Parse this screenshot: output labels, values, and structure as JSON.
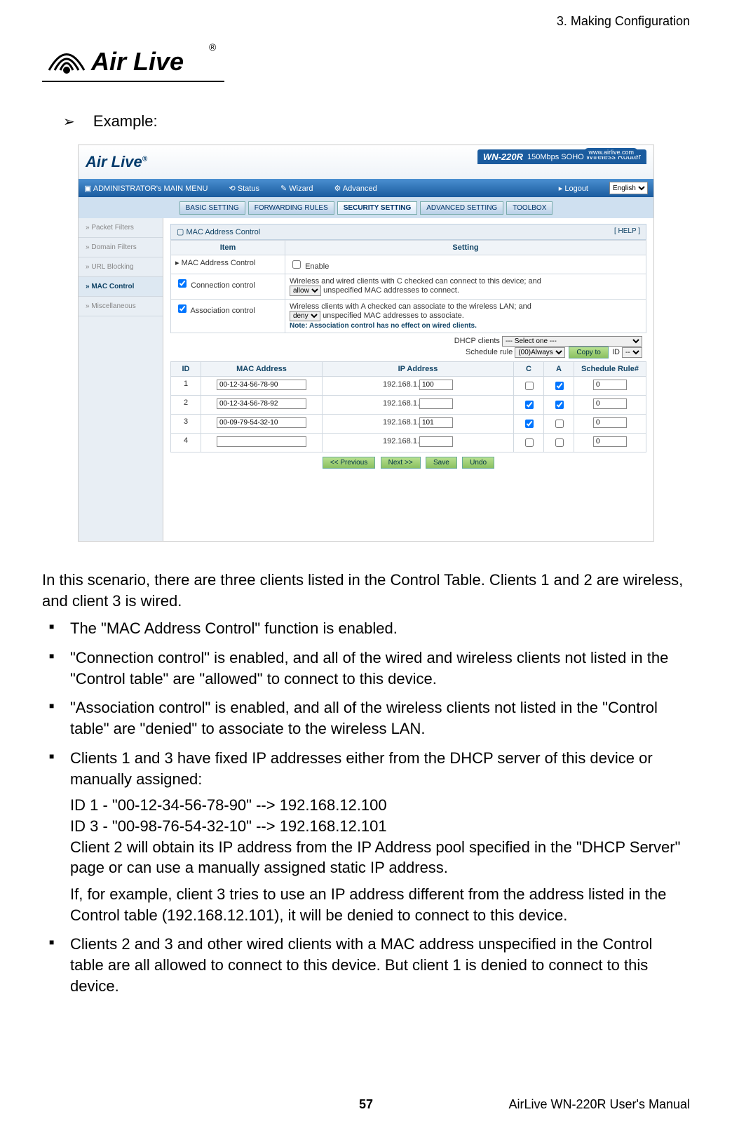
{
  "header": {
    "chapter": "3. Making Configuration"
  },
  "logo_text": "Air Live",
  "example_label": "Example:",
  "screenshot": {
    "url_pill": "www.airlive.com",
    "model": "WN-220R",
    "model_desc": "150Mbps SOHO Wireless Router",
    "menubar": {
      "main": "ADMINISTRATOR's MAIN MENU",
      "status": "Status",
      "wizard": "Wizard",
      "advanced": "Advanced",
      "logout": "Logout",
      "lang": "English"
    },
    "tabs": [
      "BASIC SETTING",
      "FORWARDING RULES",
      "SECURITY SETTING",
      "ADVANCED SETTING",
      "TOOLBOX"
    ],
    "sidebar": [
      "Packet Filters",
      "Domain Filters",
      "URL Blocking",
      "MAC Control",
      "Miscellaneous"
    ],
    "panel_title": "MAC Address Control",
    "panel_help": "[ HELP ]",
    "col_item": "Item",
    "col_setting": "Setting",
    "row_mac_label": "MAC Address Control",
    "row_mac_enable": "Enable",
    "row_conn_label": "Connection control",
    "row_conn_text1": "Wireless and wired clients with C checked can connect to this device; and",
    "row_conn_select": "allow",
    "row_conn_text2": "unspecified MAC addresses to connect.",
    "row_assoc_label": "Association control",
    "row_assoc_text1": "Wireless clients with A checked can associate to the wireless LAN; and",
    "row_assoc_select": "deny",
    "row_assoc_text2": "unspecified MAC addresses to associate.",
    "row_assoc_note": "Note: Association control has no effect on wired clients.",
    "dhcp_label": "DHCP clients",
    "dhcp_select": "--- Select one ---",
    "sched_label": "Schedule rule",
    "sched_select": "(00)Always",
    "copy_btn": "Copy to",
    "id_label": "ID",
    "id_select": "--",
    "cols": {
      "id": "ID",
      "mac": "MAC Address",
      "ip": "IP Address",
      "c": "C",
      "a": "A",
      "sr": "Schedule Rule#"
    },
    "rows": [
      {
        "id": "1",
        "mac": "00-12-34-56-78-90",
        "ip_prefix": "192.168.1.",
        "ip_last": "100",
        "c": false,
        "a": true,
        "sr": "0"
      },
      {
        "id": "2",
        "mac": "00-12-34-56-78-92",
        "ip_prefix": "192.168.1.",
        "ip_last": "",
        "c": true,
        "a": true,
        "sr": "0"
      },
      {
        "id": "3",
        "mac": "00-09-79-54-32-10",
        "ip_prefix": "192.168.1.",
        "ip_last": "101",
        "c": true,
        "a": false,
        "sr": "0"
      },
      {
        "id": "4",
        "mac": "",
        "ip_prefix": "192.168.1.",
        "ip_last": "",
        "c": false,
        "a": false,
        "sr": "0"
      }
    ],
    "buttons": {
      "prev": "<< Previous",
      "next": "Next >>",
      "save": "Save",
      "undo": "Undo"
    }
  },
  "para_intro": "In this scenario, there are three clients listed in the Control Table. Clients 1 and 2 are wireless, and client 3 is wired.",
  "bullets": {
    "b1": "The \"MAC Address Control\" function is enabled.",
    "b2": "\"Connection control\" is enabled, and all of the wired and wireless clients not listed in the \"Control table\" are \"allowed\" to connect to this device.",
    "b3": "\"Association control\" is enabled, and all of the wireless clients not listed in the \"Control table\" are \"denied\" to associate to the wireless LAN.",
    "b4": "Clients 1 and 3 have fixed IP addresses either from the DHCP server of this device or manually assigned:",
    "b4_sub1": "ID 1 - \"00-12-34-56-78-90\" --> 192.168.12.100",
    "b4_sub2": "ID 3 - \"00-98-76-54-32-10\" --> 192.168.12.101",
    "b4_sub3": "Client 2 will obtain its IP address from the IP Address pool specified in the \"DHCP Server\" page or can use a manually assigned static IP address.",
    "b4_sub4": "If, for example, client 3 tries to use an IP address different from the address listed in the Control table (192.168.12.101), it will be denied to connect to this device.",
    "b5": "Clients 2 and 3 and other wired clients with a MAC address unspecified in the Control table are all allowed to connect to this device. But client 1 is denied to connect to this device."
  },
  "footer": {
    "page": "57",
    "manual": "AirLive WN-220R User's Manual"
  }
}
